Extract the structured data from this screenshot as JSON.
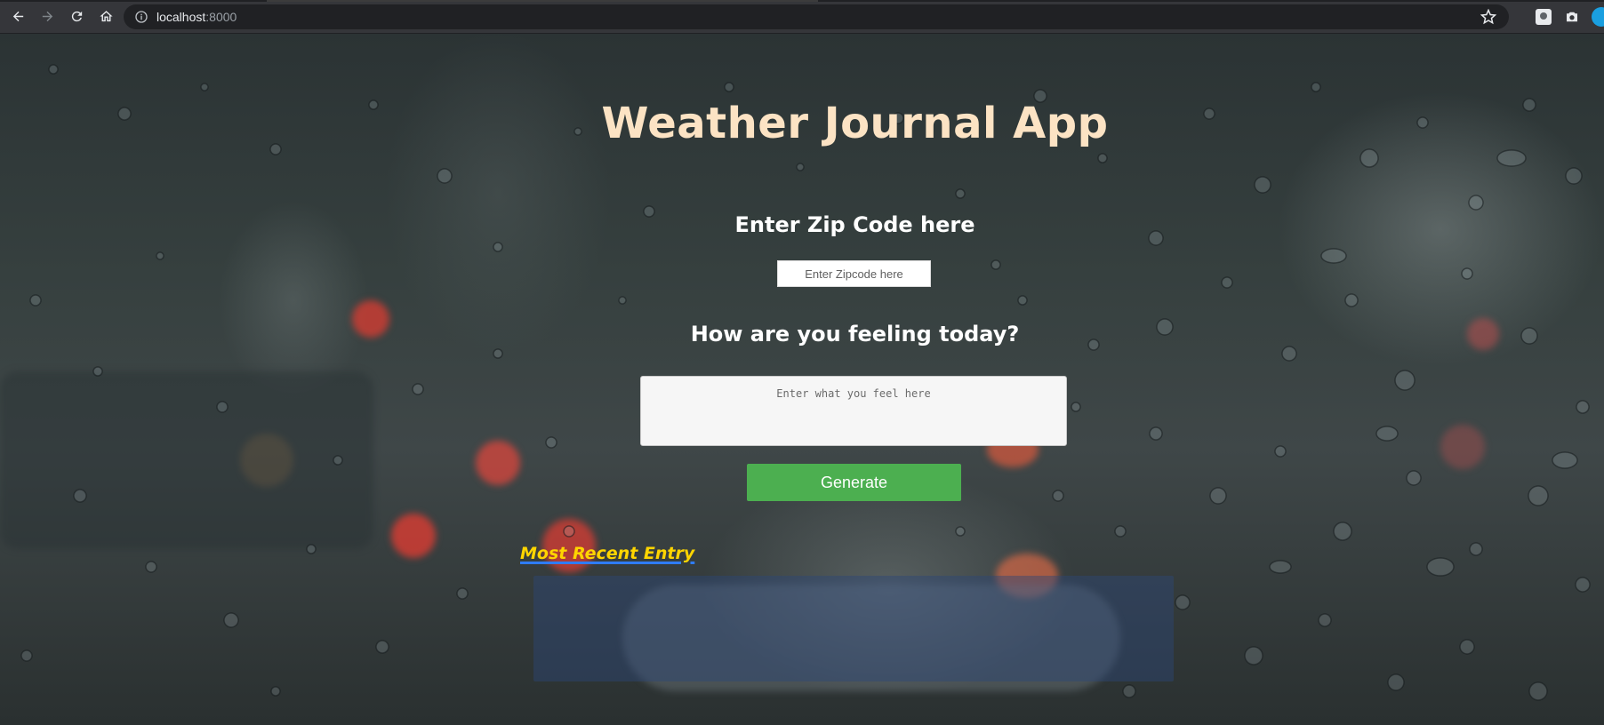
{
  "browser": {
    "url_host": "localhost",
    "url_port": ":8000"
  },
  "app": {
    "title": "Weather Journal App",
    "zip_label": "Enter Zip Code here",
    "zip_placeholder": "Enter Zipcode here",
    "feeling_label": "How are you feeling today?",
    "feeling_placeholder": "Enter what you feel here",
    "generate_label": "Generate",
    "recent_entry_label": "Most Recent Entry"
  },
  "colors": {
    "title": "#fce3c4",
    "button": "#4caf50",
    "recent_label": "#ffd500",
    "recent_underline": "#2f7cf6"
  }
}
